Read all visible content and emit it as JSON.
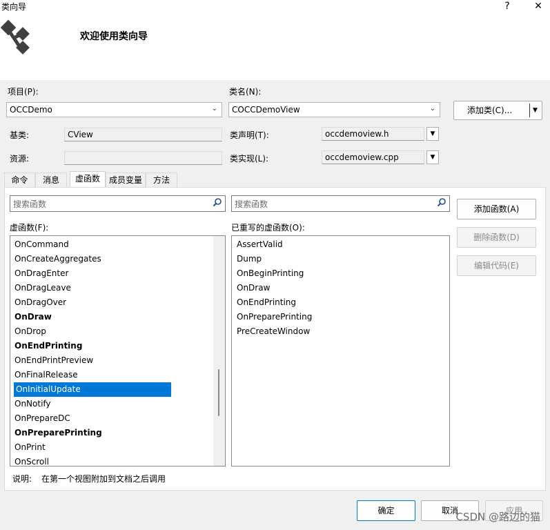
{
  "window": {
    "title": "类向导",
    "help_label": "?",
    "close_label": "✕"
  },
  "banner": {
    "title": "欢迎使用类向导",
    "logo_icon": "class-wizard-logo-icon"
  },
  "project": {
    "label": "项目(P):",
    "value": "OCCDemo"
  },
  "class_name": {
    "label": "类名(N):",
    "value": "COCCDemoView"
  },
  "add_class_button": "添加类(C)...",
  "base_class": {
    "label": "基类:",
    "value": "CView"
  },
  "resource": {
    "label": "资源:",
    "value": ""
  },
  "class_declaration": {
    "label": "类声明(T):",
    "value": "occdemoview.h"
  },
  "class_implementation": {
    "label": "类实现(L):",
    "value": "occdemoview.cpp"
  },
  "tabs": [
    {
      "label": "命令",
      "active": false
    },
    {
      "label": "消息",
      "active": false
    },
    {
      "label": "虚函数",
      "active": true
    },
    {
      "label": "成员变量",
      "active": false
    },
    {
      "label": "方法",
      "active": false
    }
  ],
  "search_left": {
    "placeholder": "搜索函数"
  },
  "search_right": {
    "placeholder": "搜索函数"
  },
  "virtual_functions": {
    "label": "虚函数(F):",
    "items": [
      {
        "name": "OnCommand",
        "bold": false
      },
      {
        "name": "OnCreateAggregates",
        "bold": false
      },
      {
        "name": "OnDragEnter",
        "bold": false
      },
      {
        "name": "OnDragLeave",
        "bold": false
      },
      {
        "name": "OnDragOver",
        "bold": false
      },
      {
        "name": "OnDraw",
        "bold": true
      },
      {
        "name": "OnDrop",
        "bold": false
      },
      {
        "name": "OnEndPrinting",
        "bold": true
      },
      {
        "name": "OnEndPrintPreview",
        "bold": false
      },
      {
        "name": "OnFinalRelease",
        "bold": false
      },
      {
        "name": "OnInitialUpdate",
        "bold": false,
        "selected": true
      },
      {
        "name": "OnNotify",
        "bold": false
      },
      {
        "name": "OnPrepareDC",
        "bold": false
      },
      {
        "name": "OnPreparePrinting",
        "bold": true
      },
      {
        "name": "OnPrint",
        "bold": false
      },
      {
        "name": "OnScroll",
        "bold": false
      }
    ]
  },
  "overridden_functions": {
    "label": "已重写的虚函数(O):",
    "items": [
      "AssertValid",
      "Dump",
      "OnBeginPrinting",
      "OnDraw",
      "OnEndPrinting",
      "OnPreparePrinting",
      "PreCreateWindow"
    ]
  },
  "buttons": {
    "add_function": "添加函数(A)",
    "delete_function": "删除函数(D)",
    "edit_code": "编辑代码(E)",
    "ok": "确定",
    "cancel": "取消",
    "apply": "应用"
  },
  "description": {
    "label": "说明:",
    "text": "在第一个视图附加到文档之后调用"
  },
  "watermark": "CSDN @路边的猫",
  "colors": {
    "selection": "#0078d7",
    "default_button_border": "#0078d4"
  }
}
